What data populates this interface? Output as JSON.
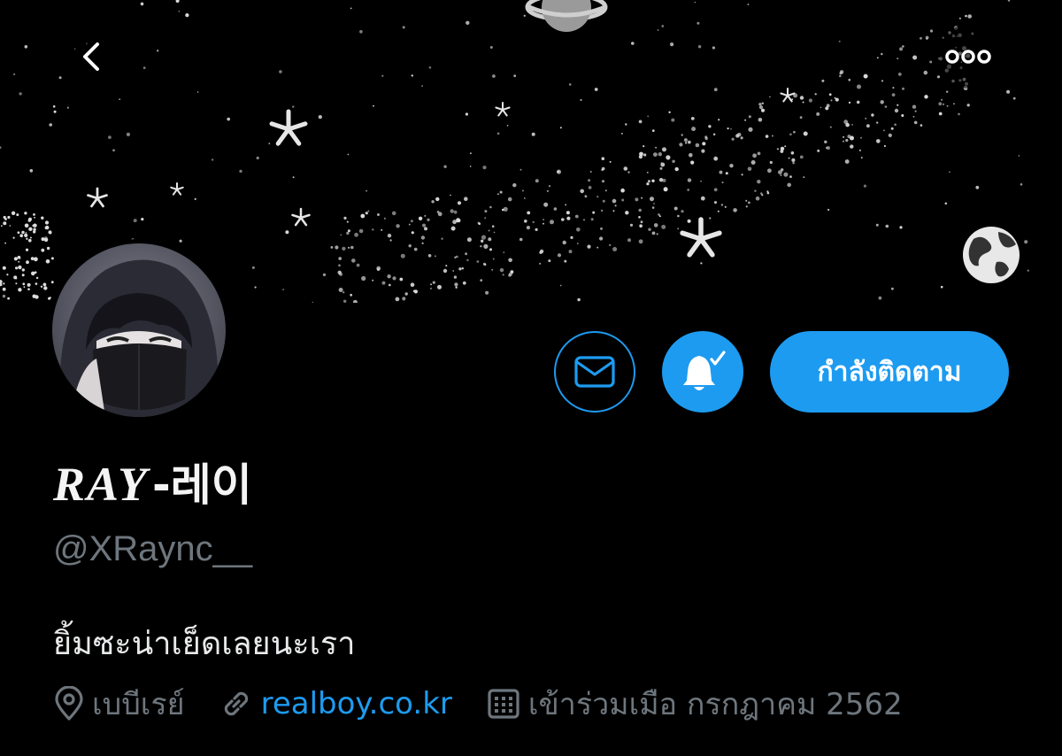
{
  "header": {
    "back_icon": "chevron-left-icon",
    "more_icon": "more-horizontal-icon"
  },
  "profile": {
    "name_latin": "RAY",
    "name_rest": "-레이",
    "handle": "@XRaync__",
    "bio": "ยิ้มซะน่าเย็ดเลยนะเรา",
    "location": "เบบีเรย์",
    "website": "realboy.co.kr",
    "joined": "เข้าร่วมเมือ กรกฎาคม 2562"
  },
  "actions": {
    "message_icon": "mail-icon",
    "notification_icon": "bell-subscribed-icon",
    "follow_label": "กำลังติดตาม"
  },
  "colors": {
    "accent": "#1d9bf0",
    "muted": "#6e767d",
    "background": "#000000",
    "text": "#e7e9ea"
  }
}
